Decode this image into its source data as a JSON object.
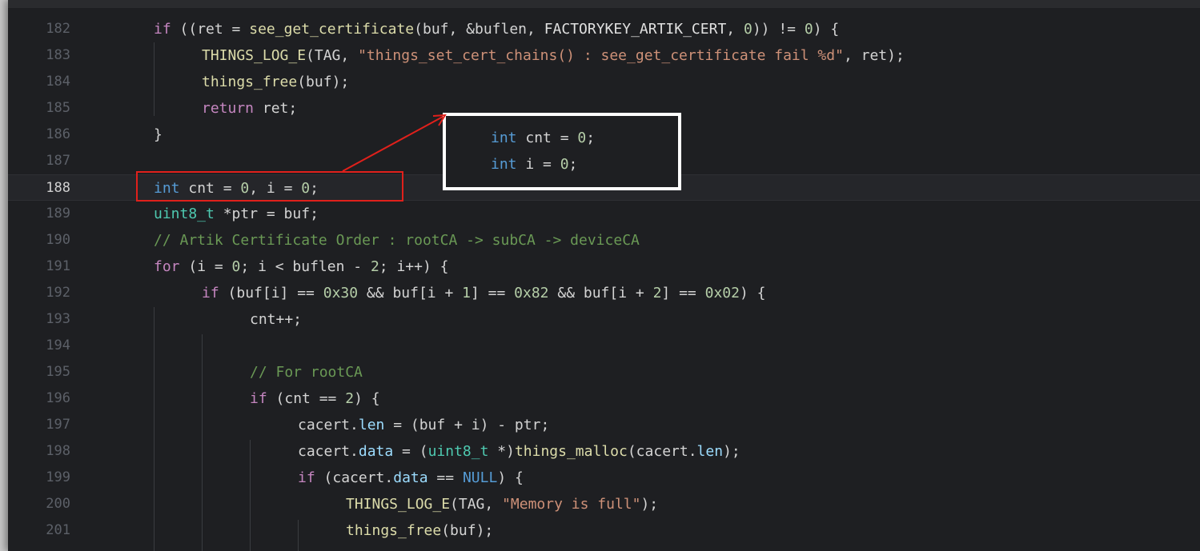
{
  "editor": {
    "current_line": "188",
    "lines": [
      {
        "n": "182",
        "indent": 0,
        "tokens": [
          [
            "kw2",
            "if"
          ],
          [
            "id",
            " (("
          ],
          [
            "id",
            "ret"
          ],
          [
            "id",
            " = "
          ],
          [
            "fn",
            "see_get_certificate"
          ],
          [
            "id",
            "(buf, &buflen, "
          ],
          [
            "mc",
            "FACTORYKEY_ARTIK_CERT"
          ],
          [
            "id",
            ", "
          ],
          [
            "num",
            "0"
          ],
          [
            "id",
            ")) != "
          ],
          [
            "num",
            "0"
          ],
          [
            "id",
            ") {"
          ]
        ]
      },
      {
        "n": "183",
        "indent": 1,
        "tokens": [
          [
            "fn",
            "THINGS_LOG_E"
          ],
          [
            "id",
            "(TAG, "
          ],
          [
            "str",
            "\"things_set_cert_chains() : see_get_certificate fail %d\""
          ],
          [
            "id",
            ", ret);"
          ]
        ]
      },
      {
        "n": "184",
        "indent": 1,
        "tokens": [
          [
            "fn",
            "things_free"
          ],
          [
            "id",
            "(buf);"
          ]
        ]
      },
      {
        "n": "185",
        "indent": 1,
        "tokens": [
          [
            "kw2",
            "return"
          ],
          [
            "id",
            " ret;"
          ]
        ]
      },
      {
        "n": "186",
        "indent": 0,
        "tokens": [
          [
            "id",
            "}"
          ]
        ]
      },
      {
        "n": "187",
        "indent": 0,
        "tokens": []
      },
      {
        "n": "188",
        "indent": 0,
        "tokens": [
          [
            "kw",
            "int"
          ],
          [
            "id",
            " cnt = "
          ],
          [
            "num",
            "0"
          ],
          [
            "id",
            ", i = "
          ],
          [
            "num",
            "0"
          ],
          [
            "id",
            ";"
          ]
        ]
      },
      {
        "n": "189",
        "indent": 0,
        "tokens": [
          [
            "ty",
            "uint8_t"
          ],
          [
            "id",
            " *ptr = buf;"
          ]
        ]
      },
      {
        "n": "190",
        "indent": 0,
        "tokens": [
          [
            "cm",
            "// Artik Certificate Order : rootCA -> subCA -> deviceCA"
          ]
        ]
      },
      {
        "n": "191",
        "indent": 0,
        "tokens": [
          [
            "kw2",
            "for"
          ],
          [
            "id",
            " (i = "
          ],
          [
            "num",
            "0"
          ],
          [
            "id",
            "; i < buflen - "
          ],
          [
            "num",
            "2"
          ],
          [
            "id",
            "; i++) {"
          ]
        ]
      },
      {
        "n": "192",
        "indent": 1,
        "tokens": [
          [
            "kw2",
            "if"
          ],
          [
            "id",
            " (buf[i] == "
          ],
          [
            "num",
            "0x30"
          ],
          [
            "id",
            " && buf[i + "
          ],
          [
            "num",
            "1"
          ],
          [
            "id",
            "] == "
          ],
          [
            "num",
            "0x82"
          ],
          [
            "id",
            " && buf[i + "
          ],
          [
            "num",
            "2"
          ],
          [
            "id",
            "] == "
          ],
          [
            "num",
            "0x02"
          ],
          [
            "id",
            ") {"
          ]
        ]
      },
      {
        "n": "193",
        "indent": 2,
        "tokens": [
          [
            "id",
            "cnt++;"
          ]
        ]
      },
      {
        "n": "194",
        "indent": 2,
        "tokens": []
      },
      {
        "n": "195",
        "indent": 2,
        "tokens": [
          [
            "cm",
            "// For rootCA"
          ]
        ]
      },
      {
        "n": "196",
        "indent": 2,
        "tokens": [
          [
            "kw2",
            "if"
          ],
          [
            "id",
            " (cnt == "
          ],
          [
            "num",
            "2"
          ],
          [
            "id",
            ") {"
          ]
        ]
      },
      {
        "n": "197",
        "indent": 3,
        "tokens": [
          [
            "id",
            "cacert."
          ],
          [
            "mem",
            "len"
          ],
          [
            "id",
            " = (buf + i) - ptr;"
          ]
        ]
      },
      {
        "n": "198",
        "indent": 3,
        "tokens": [
          [
            "id",
            "cacert."
          ],
          [
            "mem",
            "data"
          ],
          [
            "id",
            " = ("
          ],
          [
            "ty",
            "uint8_t"
          ],
          [
            "id",
            " *)"
          ],
          [
            "fn",
            "things_malloc"
          ],
          [
            "id",
            "(cacert."
          ],
          [
            "mem",
            "len"
          ],
          [
            "id",
            ");"
          ]
        ]
      },
      {
        "n": "199",
        "indent": 3,
        "tokens": [
          [
            "kw2",
            "if"
          ],
          [
            "id",
            " (cacert."
          ],
          [
            "mem",
            "data"
          ],
          [
            "id",
            " == "
          ],
          [
            "const",
            "NULL"
          ],
          [
            "id",
            ") {"
          ]
        ]
      },
      {
        "n": "200",
        "indent": 4,
        "tokens": [
          [
            "fn",
            "THINGS_LOG_E"
          ],
          [
            "id",
            "(TAG, "
          ],
          [
            "str",
            "\"Memory is full\""
          ],
          [
            "id",
            ");"
          ]
        ]
      },
      {
        "n": "201",
        "indent": 4,
        "tokens": [
          [
            "fn",
            "things_free"
          ],
          [
            "id",
            "(buf);"
          ]
        ]
      }
    ]
  },
  "callout": {
    "line1_kw": "int",
    "line1_rest": " cnt = ",
    "line1_num": "0",
    "line1_end": ";",
    "line2_kw": "int",
    "line2_rest": " i = ",
    "line2_num": "0",
    "line2_end": ";"
  },
  "colors": {
    "highlight_box": "#e0201b",
    "callout_border": "#ffffff",
    "arrow": "#e0201b"
  }
}
